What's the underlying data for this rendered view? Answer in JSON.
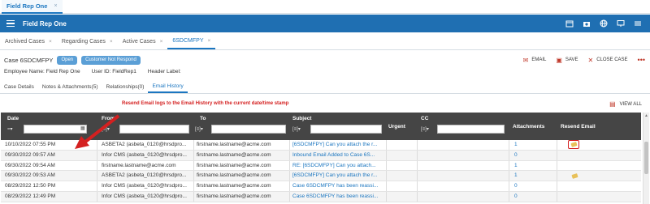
{
  "top_tab": {
    "label": "Field Rep One",
    "close": "×"
  },
  "appbar": {
    "title": "Field Rep One"
  },
  "case_tabs": [
    {
      "label": "Archived Cases",
      "close": "×"
    },
    {
      "label": "Regarding Cases",
      "close": "×"
    },
    {
      "label": "Active Cases",
      "close": "×"
    },
    {
      "label": "6SDCMFPY",
      "close": "×"
    }
  ],
  "case": {
    "id_label": "Case 6SDCMFPY",
    "badges": [
      "Open",
      "Customer Not Respond"
    ],
    "actions": {
      "email": "EMAIL",
      "save": "SAVE",
      "close_case": "CLOSE CASE"
    },
    "employee_name": "Employee Name:  Field Rep One",
    "user_id": "User ID:  FieldRep1",
    "header_label": "Header Label:"
  },
  "sub_tabs": [
    "Case Details",
    "Notes & Attachments(5)",
    "Relationships(0)",
    "Email History"
  ],
  "annotation": "Resend Email logs to the Email History with the current date/time stamp",
  "view_all": "VIEW ALL",
  "grid": {
    "columns": [
      "Date",
      "From",
      "To",
      "Subject",
      "Urgent",
      "CC",
      "Attachments",
      "Resend Email"
    ],
    "filter_ops": [
      "=▾",
      "[≡]▾",
      "[≡]▾",
      "[≡]▾",
      "[≡]▾"
    ],
    "rows": [
      {
        "date": "10/10/2022 07:55 PM",
        "from": "ASBETA2 (asbeta_0120@hrsdpro...",
        "to": "firstname.lastname@acme.com",
        "subject": "[6SDCMFPY] Can you attach the r...",
        "attachments": "1",
        "resend": true,
        "highlight": true
      },
      {
        "date": "09/30/2022 09:57 AM",
        "from": "Infor CMS (asbeta_0120@hrsdpro...",
        "to": "firstname.lastname@acme.com",
        "subject": "Inbound Email Added to Case 6S...",
        "attachments": "0",
        "resend": false
      },
      {
        "date": "09/30/2022 09:54 AM",
        "from": "firstname.lastname@acme.com",
        "to": "firstname.lastname@acme.com",
        "subject": "RE: [6SDCMFPY] Can you attach...",
        "attachments": "1",
        "resend": false
      },
      {
        "date": "09/30/2022 09:53 AM",
        "from": "ASBETA2 (asbeta_0120@hrsdpro...",
        "to": "firstname.lastname@acme.com",
        "subject": "[6SDCMFPY] Can you attach the r...",
        "attachments": "1",
        "resend": true
      },
      {
        "date": "08/29/2022 12:50 PM",
        "from": "Infor CMS (asbeta_0120@hrsdpro...",
        "to": "firstname.lastname@acme.com",
        "subject": "Case 6SDCMFPY has been reassi...",
        "attachments": "0",
        "resend": false
      },
      {
        "date": "08/29/2022 12:49 PM",
        "from": "Infor CMS (asbeta_0120@hrsdpro...",
        "to": "firstname.lastname@acme.com",
        "subject": "Case 6SDCMFPY has been reassi...",
        "attachments": "0",
        "resend": false
      }
    ]
  },
  "colors": {
    "brand_blue": "#1f6fb2",
    "link_blue": "#1b76c0",
    "header_dark": "#454545",
    "annotation_red": "#d42020"
  }
}
